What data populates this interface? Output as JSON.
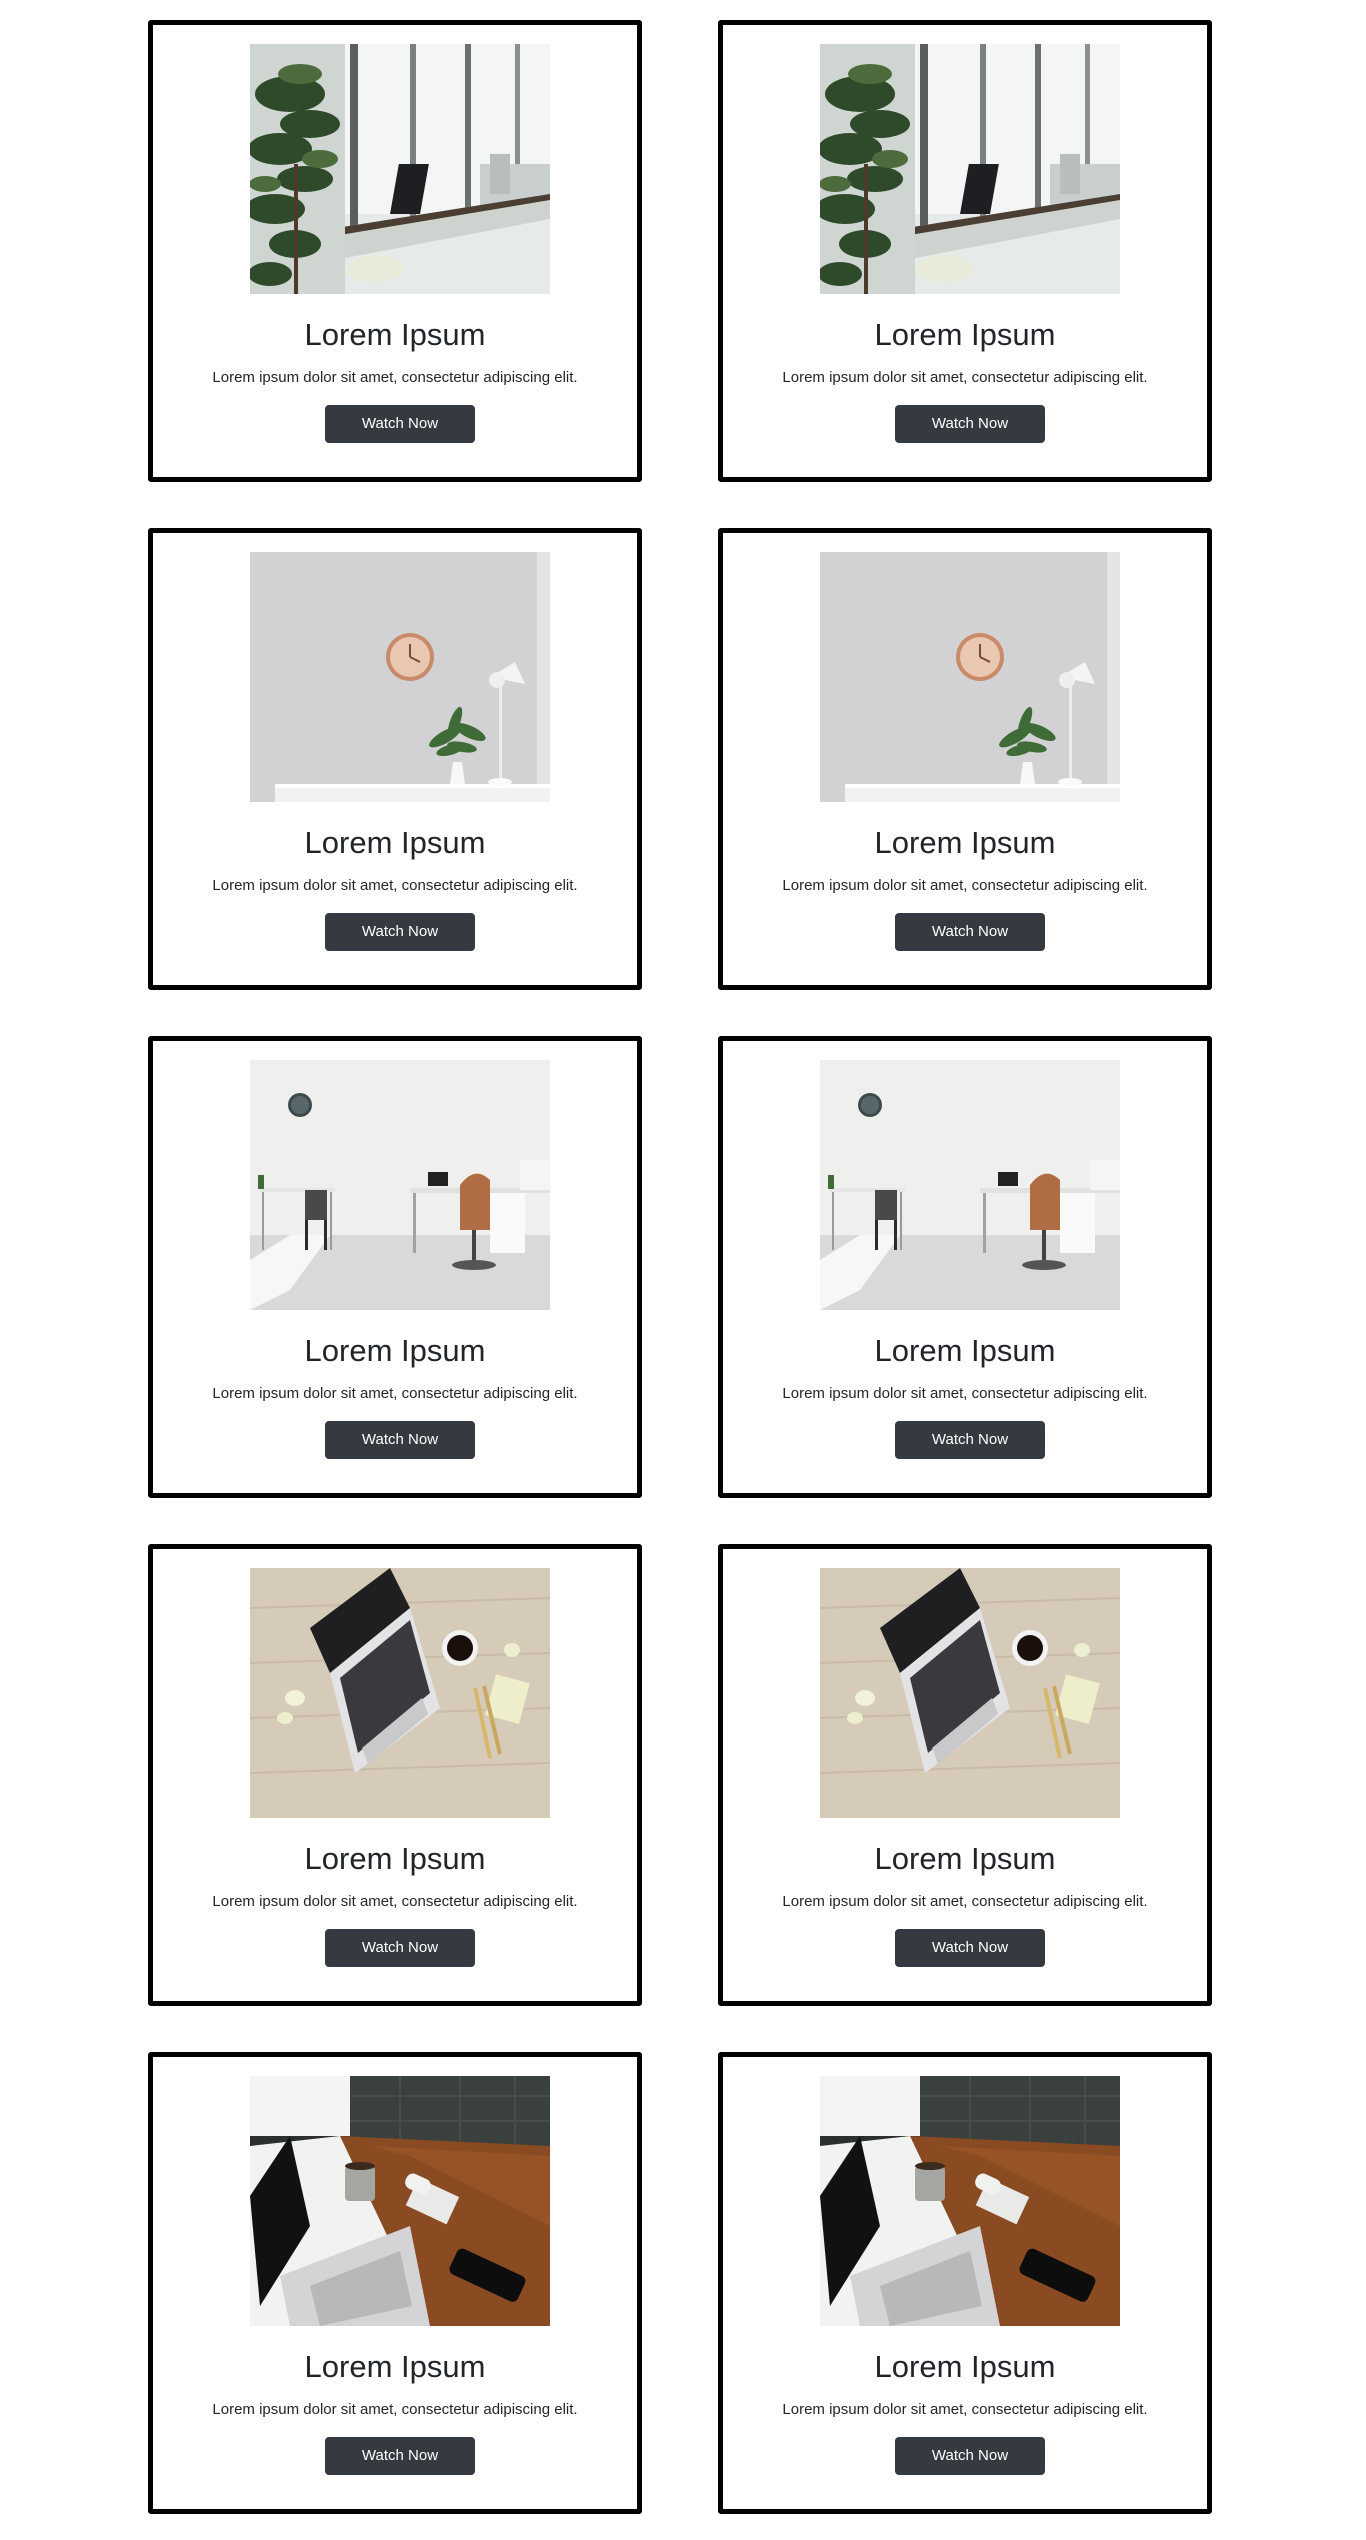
{
  "cards": [
    {
      "title": "Lorem Ipsum",
      "text": "Lorem ipsum dolor sit amet, consectetur adipiscing elit.",
      "button_label": "Watch Now",
      "image": "office-window-plants-photo"
    },
    {
      "title": "Lorem Ipsum",
      "text": "Lorem ipsum dolor sit amet, consectetur adipiscing elit.",
      "button_label": "Watch Now",
      "image": "office-window-plants-photo"
    },
    {
      "title": "Lorem Ipsum",
      "text": "Lorem ipsum dolor sit amet, consectetur adipiscing elit.",
      "button_label": "Watch Now",
      "image": "wall-clock-desk-plant-photo"
    },
    {
      "title": "Lorem Ipsum",
      "text": "Lorem ipsum dolor sit amet, consectetur adipiscing elit.",
      "button_label": "Watch Now",
      "image": "wall-clock-desk-plant-photo"
    },
    {
      "title": "Lorem Ipsum",
      "text": "Lorem ipsum dolor sit amet, consectetur adipiscing elit.",
      "button_label": "Watch Now",
      "image": "white-office-chairs-photo"
    },
    {
      "title": "Lorem Ipsum",
      "text": "Lorem ipsum dolor sit amet, consectetur adipiscing elit.",
      "button_label": "Watch Now",
      "image": "white-office-chairs-photo"
    },
    {
      "title": "Lorem Ipsum",
      "text": "Lorem ipsum dolor sit amet, consectetur adipiscing elit.",
      "button_label": "Watch Now",
      "image": "laptop-coffee-wood-desk-photo"
    },
    {
      "title": "Lorem Ipsum",
      "text": "Lorem ipsum dolor sit amet, consectetur adipiscing elit.",
      "button_label": "Watch Now",
      "image": "laptop-coffee-wood-desk-photo"
    },
    {
      "title": "Lorem Ipsum",
      "text": "Lorem ipsum dolor sit amet, consectetur adipiscing elit.",
      "button_label": "Watch Now",
      "image": "laptop-mug-dark-desk-photo"
    },
    {
      "title": "Lorem Ipsum",
      "text": "Lorem ipsum dolor sit amet, consectetur adipiscing elit.",
      "button_label": "Watch Now",
      "image": "laptop-mug-dark-desk-photo"
    }
  ],
  "colors": {
    "card_border": "#000000",
    "button_bg": "#343a40",
    "button_text": "#ffffff",
    "text": "#212529"
  }
}
